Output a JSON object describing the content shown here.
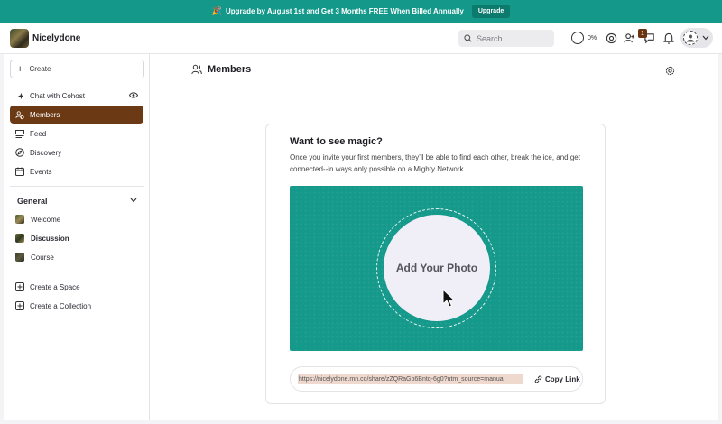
{
  "banner": {
    "icon": "party-popper-icon",
    "text": "Upgrade by August 1st and Get 3 Months FREE When Billed Annually",
    "button_label": "Upgrade"
  },
  "topbar": {
    "brand_name": "Nicelydone",
    "search_placeholder": "Search",
    "progress_value": "0%",
    "notification_count": "1"
  },
  "sidebar": {
    "create_label": "Create",
    "nav_items": [
      {
        "label": "Chat with Cohost",
        "icon": "sparkle-icon"
      },
      {
        "label": "Members",
        "icon": "members-icon",
        "active": true
      },
      {
        "label": "Feed",
        "icon": "feed-icon"
      },
      {
        "label": "Discovery",
        "icon": "compass-icon"
      },
      {
        "label": "Events",
        "icon": "calendar-icon"
      }
    ],
    "section_title": "General",
    "spaces": [
      {
        "label": "Welcome"
      },
      {
        "label": "Discussion"
      },
      {
        "label": "Course"
      }
    ],
    "actions": [
      {
        "label": "Create a Space"
      },
      {
        "label": "Create a Collection"
      }
    ]
  },
  "main": {
    "title": "Members",
    "card": {
      "title": "Want to see magic?",
      "text": "Once you invite your first members, they’ll be able to find each other, break the ice, and get connected--in ways only possible on a Mighty Network.",
      "photo_label": "Add Your Photo",
      "share_url": "https://nicelydone.mn.co/share/zZQRaGb6Bntq-6g0?utm_source=manual",
      "copy_label": "Copy Link"
    }
  },
  "colors": {
    "accent": "#13988a",
    "active_nav": "#6b3a15"
  }
}
